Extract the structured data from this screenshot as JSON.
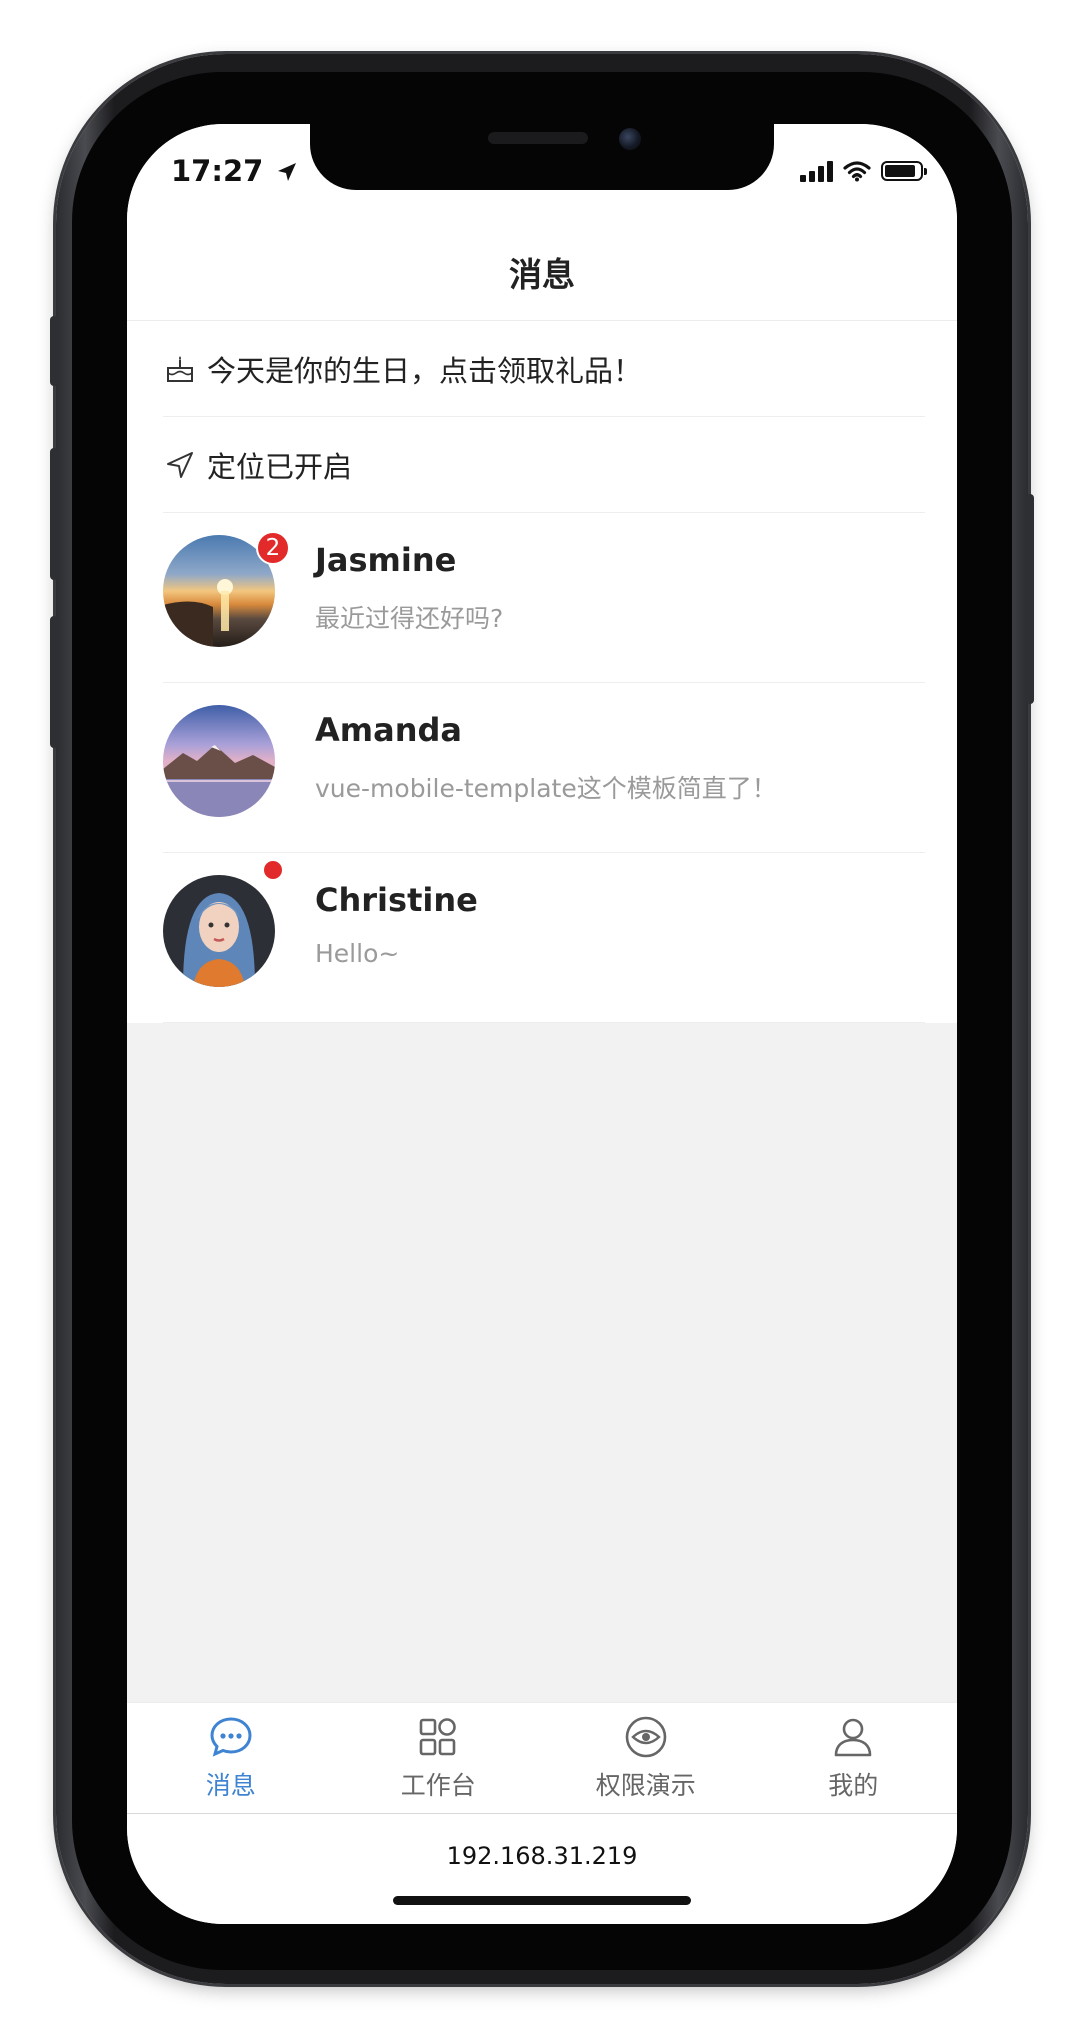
{
  "status_bar": {
    "time": "17:27"
  },
  "header": {
    "title": "消息"
  },
  "notices": [
    {
      "icon": "cake-icon",
      "text": "今天是你的生日，点击领取礼品！"
    },
    {
      "icon": "location-arrow-icon",
      "text": "定位已开启"
    }
  ],
  "chats": [
    {
      "name": "Jasmine",
      "preview": "最近过得还好吗?",
      "unread": "2"
    },
    {
      "name": "Amanda",
      "preview": "vue-mobile-template这个模板简直了！"
    },
    {
      "name": "Christine",
      "preview": "Hello~"
    }
  ],
  "tabbar": {
    "items": [
      {
        "label": "消息",
        "icon": "chat-bubble-icon",
        "active": true
      },
      {
        "label": "工作台",
        "icon": "grid-icon"
      },
      {
        "label": "权限演示",
        "icon": "eye-icon"
      },
      {
        "label": "我的",
        "icon": "user-icon"
      }
    ]
  },
  "browser": {
    "address": "192.168.31.219"
  },
  "colors": {
    "accent": "#3f84d2",
    "badge": "#e32a2a",
    "background": "#f2f2f2"
  }
}
